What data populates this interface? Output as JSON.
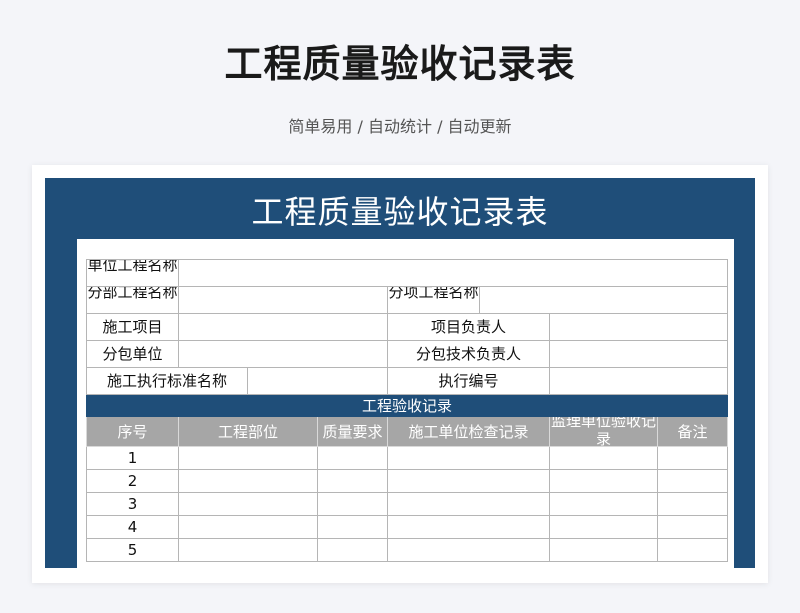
{
  "page": {
    "title": "工程质量验收记录表",
    "tagline": "简单易用 / 自动统计 / 自动更新"
  },
  "sheet": {
    "title": "工程质量验收记录表",
    "labels": {
      "unit_project": "单位工程名称",
      "sub_project": "分部工程名称",
      "item_project": "分项工程名称",
      "construction_item": "施工项目",
      "item_manager": "项目负责人",
      "subcontractor": "分包单位",
      "sub_tech_manager": "分包技术负责人",
      "standard_name": "施工执行标准名称",
      "exec_number": "执行编号"
    },
    "section_title": "工程验收记录",
    "columns": [
      "序号",
      "工程部位",
      "质量要求",
      "施工单位检查记录",
      "监理单位验收记录",
      "备注"
    ],
    "rows": [
      "1",
      "2",
      "3",
      "4",
      "5"
    ]
  }
}
